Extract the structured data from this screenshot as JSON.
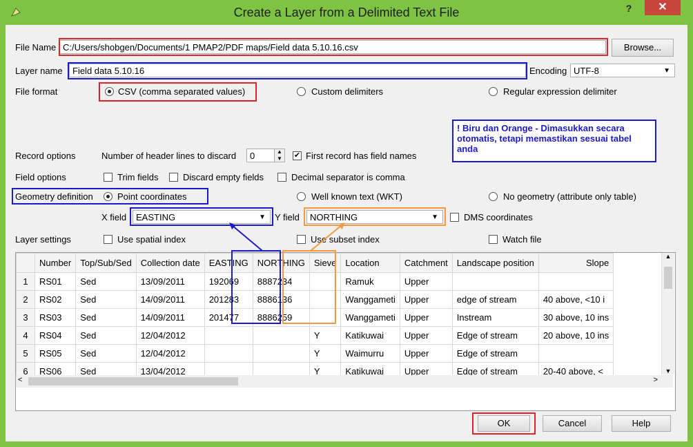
{
  "window": {
    "title": "Create a Layer from a Delimited Text File",
    "help_label": "?",
    "close_label": "✕"
  },
  "file": {
    "label": "File Name",
    "value": "C:/Users/shobgen/Documents/1 PMAP2/PDF maps/Field data 5.10.16.csv",
    "browse_label": "Browse..."
  },
  "layer": {
    "label": "Layer name",
    "value": "Field data 5.10.16",
    "encoding_label": "Encoding",
    "encoding_value": "UTF-8"
  },
  "format": {
    "label": "File format",
    "options": [
      "CSV (comma separated values)",
      "Custom delimiters",
      "Regular expression delimiter"
    ],
    "selected": 0
  },
  "note": "! Biru dan Orange - Dimasukkan secara otomatis, tetapi memastikan sesuai tabel anda",
  "record": {
    "label": "Record options",
    "header_lines_label": "Number of header lines to discard",
    "header_lines_value": "0",
    "first_record_label": "First record has field names",
    "first_record_checked": true
  },
  "field_opts": {
    "label": "Field options",
    "trim": "Trim fields",
    "discard": "Discard empty fields",
    "decimal": "Decimal separator is comma"
  },
  "geometry": {
    "label": "Geometry definition",
    "options": [
      "Point coordinates",
      "Well known text (WKT)",
      "No geometry (attribute only table)"
    ],
    "selected": 0,
    "x_label": "X field",
    "x_value": "EASTING",
    "y_label": "Y field",
    "y_value": "NORTHING",
    "dms_label": "DMS coordinates"
  },
  "layer_settings": {
    "label": "Layer settings",
    "spatial": "Use spatial index",
    "subset": "Use subset index",
    "watch": "Watch file"
  },
  "table": {
    "columns": [
      "",
      "Number",
      "Top/Sub/Sed",
      "Collection date",
      "EASTING",
      "NORTHING",
      "Sieve",
      "Location",
      "Catchment",
      "Landscape position",
      "Slope"
    ],
    "rows": [
      [
        "1",
        "RS01",
        "Sed",
        "13/09/2011",
        "192069",
        "8887234",
        "",
        "Ramuk",
        "Upper",
        "",
        ""
      ],
      [
        "2",
        "RS02",
        "Sed",
        "14/09/2011",
        "201283",
        "8886136",
        "",
        "Wanggameti",
        "Upper",
        "edge of stream",
        "40 above, <10 i"
      ],
      [
        "3",
        "RS03",
        "Sed",
        "14/09/2011",
        "201477",
        "8886259",
        "",
        "Wanggameti",
        "Upper",
        "Instream",
        "30 above, 10 ins"
      ],
      [
        "4",
        "RS04",
        "Sed",
        "12/04/2012",
        "",
        "",
        "Y",
        "Katikuwai",
        "Upper",
        "Edge of stream",
        "20 above, 10 ins"
      ],
      [
        "5",
        "RS05",
        "Sed",
        "12/04/2012",
        "",
        "",
        "Y",
        "Waimurru",
        "Upper",
        "Edge of stream",
        ""
      ],
      [
        "6",
        "RS06",
        "Sed",
        "13/04/2012",
        "",
        "",
        "Y",
        "Katikuwai",
        "Upper",
        "Edge of stream",
        "20-40 above, <"
      ]
    ]
  },
  "buttons": {
    "ok": "OK",
    "cancel": "Cancel",
    "help": "Help"
  },
  "colors": {
    "frame": "#7ec341",
    "highlight_red": "#e0202a",
    "highlight_blue": "#1a1ac8",
    "highlight_orange": "#f59a3a"
  }
}
